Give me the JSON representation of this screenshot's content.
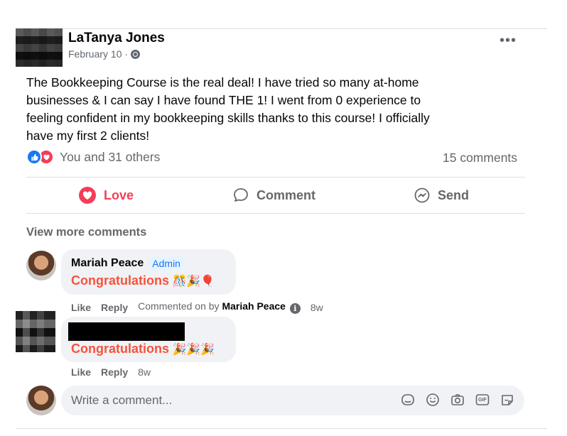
{
  "post": {
    "author": "LaTanya Jones",
    "date": "February 10 ·",
    "more_label": "•••",
    "text": "The Bookkeeping Course is the real deal! I have tried so many at-home businesses & I can say I have found THE 1! I went from 0 experience to feeling confident in my bookkeeping skills thanks to this course! I officially have my first 2 clients!",
    "reactions_text": "You and 31 others",
    "comments_count": "15 comments"
  },
  "actions": {
    "love": "Love",
    "comment": "Comment",
    "send": "Send"
  },
  "comments_section": {
    "view_more": "View more comments",
    "comments": [
      {
        "author": "Mariah Peace",
        "badge": "Admin",
        "text": "Congratulations",
        "emojis": "🎊🎉🎈",
        "like": "Like",
        "reply": "Reply",
        "commented_on_by_prefix": "Commented on by",
        "commented_on_by_name": "Mariah Peace",
        "time": "8w"
      },
      {
        "author": "",
        "text": "Congratulations",
        "emojis": "🎉🎉🎉",
        "like": "Like",
        "reply": "Reply",
        "time": "8w"
      }
    ]
  },
  "composer": {
    "placeholder": "Write a comment...",
    "icons": [
      "sticker-icon",
      "emoji-icon",
      "camera-icon",
      "gif-icon",
      "avatar-sticker-icon"
    ],
    "gif_label": "GIF"
  },
  "colors": {
    "love": "#f33e58",
    "like": "#1877f2",
    "congrats": "#f5533d",
    "muted": "#65676b"
  }
}
